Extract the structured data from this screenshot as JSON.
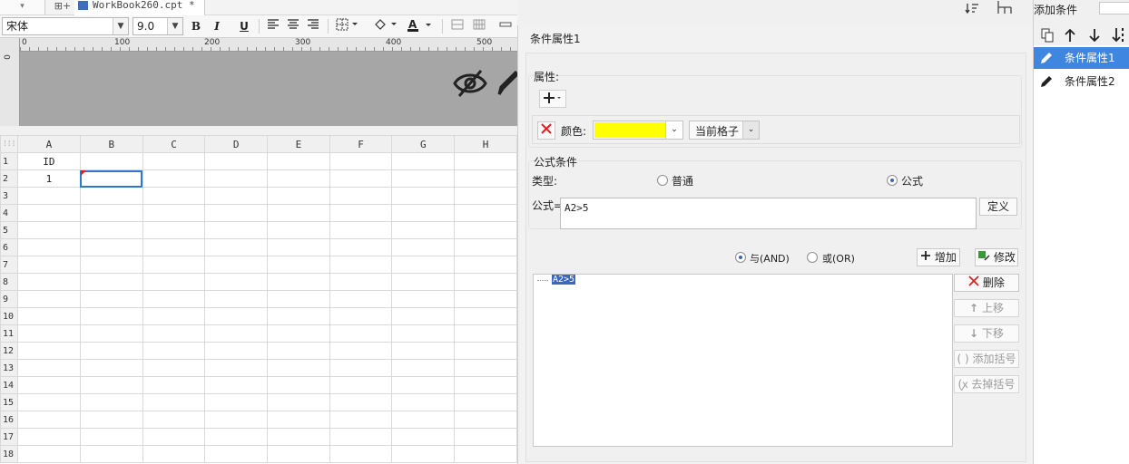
{
  "tab": {
    "filename": "WorkBook260.cpt *"
  },
  "toolbar": {
    "font_name": "宋体",
    "font_size": "9.0",
    "bold": "B",
    "italic": "I",
    "underline": "U"
  },
  "ruler": {
    "h_ticks": [
      "0",
      "100",
      "200",
      "300",
      "400",
      "500"
    ],
    "v_tick": "0"
  },
  "grid": {
    "columns": [
      "A",
      "B",
      "C",
      "D",
      "E",
      "F",
      "G",
      "H"
    ],
    "rows": [
      "1",
      "2",
      "3",
      "4",
      "5",
      "6",
      "7",
      "8",
      "9",
      "10",
      "11",
      "12",
      "13",
      "14",
      "15",
      "16",
      "17",
      "18"
    ],
    "cells": {
      "A1": "ID",
      "A2": "1"
    },
    "selected_column": "B",
    "selected_cell": "B2"
  },
  "dialog": {
    "title": "条件属性1",
    "properties_section": "属性:",
    "color_label": "颜色:",
    "color_value": "#ffff00",
    "scope_value": "当前格子",
    "formula_section": "公式条件",
    "type_label": "类型:",
    "type_normal": "普通",
    "type_formula": "公式",
    "formula_label": "公式=",
    "formula_value": "A2>5",
    "define_button": "定义",
    "and_label": "与(AND)",
    "or_label": "或(OR)",
    "add_button": "增加",
    "modify_button": "修改",
    "condition_list": [
      "A2>5"
    ],
    "delete_button": "删除",
    "move_up_button": "上移",
    "move_down_button": "下移",
    "add_bracket_button": "添加括号",
    "remove_bracket_button": "去掉括号"
  },
  "side": {
    "add_condition": "添加条件",
    "items": [
      {
        "label": "条件属性1",
        "selected": true
      },
      {
        "label": "条件属性2",
        "selected": false
      }
    ]
  },
  "colors": {
    "accent": "#3f86e0",
    "selection": "#2f78d2",
    "delete_red": "#e02020"
  }
}
